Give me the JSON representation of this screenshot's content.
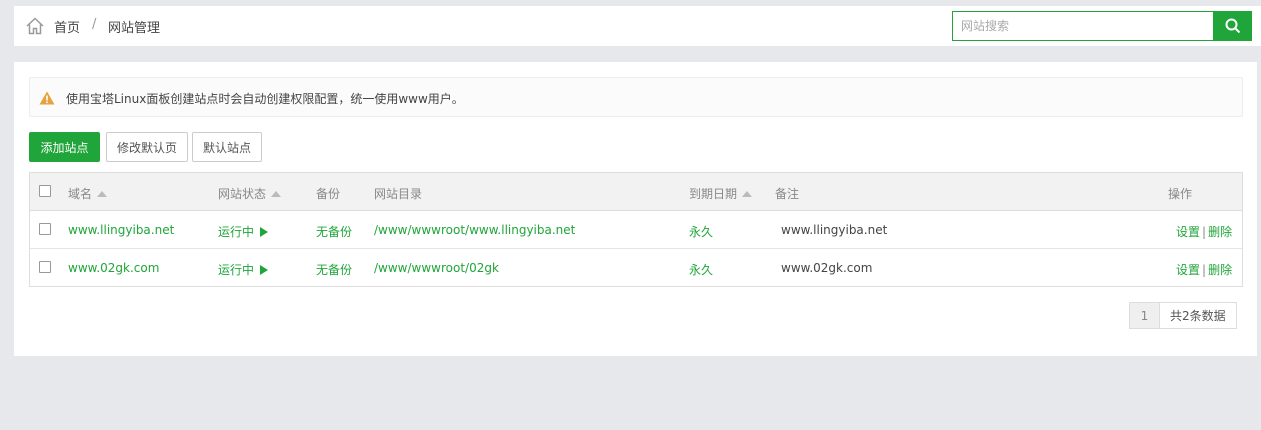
{
  "breadcrumb": {
    "home": "首页",
    "separator": "/",
    "current": "网站管理"
  },
  "search": {
    "placeholder": "网站搜索",
    "icon": "search-icon"
  },
  "notice": {
    "text": "使用宝塔Linux面板创建站点时会自动创建权限配置，统一使用www用户。",
    "icon": "warning-icon",
    "color": "#e6a23c"
  },
  "toolbar": {
    "add_site": "添加站点",
    "edit_default_page": "修改默认页",
    "default_site": "默认站点"
  },
  "table": {
    "headers": {
      "domain": "域名",
      "status": "网站状态",
      "backup": "备份",
      "dir": "网站目录",
      "expire": "到期日期",
      "remark": "备注",
      "ops": "操作"
    },
    "rows": [
      {
        "domain": "www.llingyiba.net",
        "status": "运行中",
        "backup": "无备份",
        "dir": "/www/wwwroot/www.llingyiba.net",
        "expire": "永久",
        "remark": "www.llingyiba.net",
        "settings": "设置",
        "delete": "删除"
      },
      {
        "domain": "www.02gk.com",
        "status": "运行中",
        "backup": "无备份",
        "dir": "/www/wwwroot/02gk",
        "expire": "永久",
        "remark": "www.02gk.com",
        "settings": "设置",
        "delete": "删除"
      }
    ]
  },
  "pagination": {
    "page": "1",
    "total": "共2条数据"
  },
  "colors": {
    "accent": "#20a53a",
    "background": "#e6e8eb"
  }
}
